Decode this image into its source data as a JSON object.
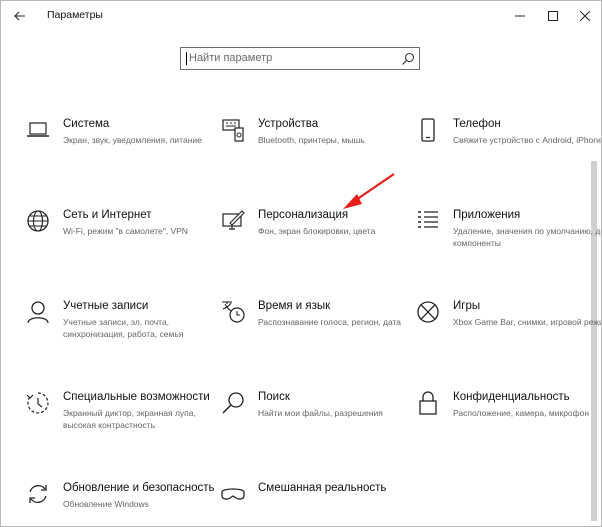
{
  "window": {
    "title": "Параметры"
  },
  "search": {
    "placeholder": "Найти параметр"
  },
  "colors": {
    "arrow": "#e8201c",
    "text": "#111111",
    "secondary_text": "#666666"
  },
  "items": [
    {
      "name": "Система",
      "desc": "Экран, звук, уведомления, питание",
      "icon": "laptop-icon"
    },
    {
      "name": "Устройства",
      "desc": "Bluetooth, принтеры, мышь",
      "icon": "devices-icon"
    },
    {
      "name": "Телефон",
      "desc": "Свяжите устройство с Android, iPhone",
      "icon": "phone-icon"
    },
    {
      "name": "Сеть и Интернет",
      "desc": "Wi-Fi, режим \"в самолете\", VPN",
      "icon": "globe-icon"
    },
    {
      "name": "Персонализация",
      "desc": "Фон, экран блокировки, цвета",
      "icon": "personalization-icon"
    },
    {
      "name": "Приложения",
      "desc": "Удаление, значения по умолчанию, доп. компоненты",
      "icon": "apps-list-icon"
    },
    {
      "name": "Учетные записи",
      "desc": "Учетные записи, эл. почта, синхронизация, работа, семья",
      "icon": "person-icon"
    },
    {
      "name": "Время и язык",
      "desc": "Распознавание голоса, регион, дата",
      "icon": "time-language-icon"
    },
    {
      "name": "Игры",
      "desc": "Xbox Game Bar, снимки, игровой режим",
      "icon": "xbox-icon"
    },
    {
      "name": "Специальные возможности",
      "desc": "Экранный диктор, экранная лупа, высокая контрастность",
      "icon": "accessibility-icon"
    },
    {
      "name": "Поиск",
      "desc": "Найти мои файлы, разрешения",
      "icon": "search-icon"
    },
    {
      "name": "Конфиденциальность",
      "desc": "Расположение, камера, микрофон",
      "icon": "lock-icon"
    },
    {
      "name": "Обновление и безопасность",
      "desc": "Обновление Windows",
      "icon": "update-icon"
    },
    {
      "name": "Смешанная реальность",
      "desc": "",
      "icon": "vr-headset-icon"
    }
  ]
}
